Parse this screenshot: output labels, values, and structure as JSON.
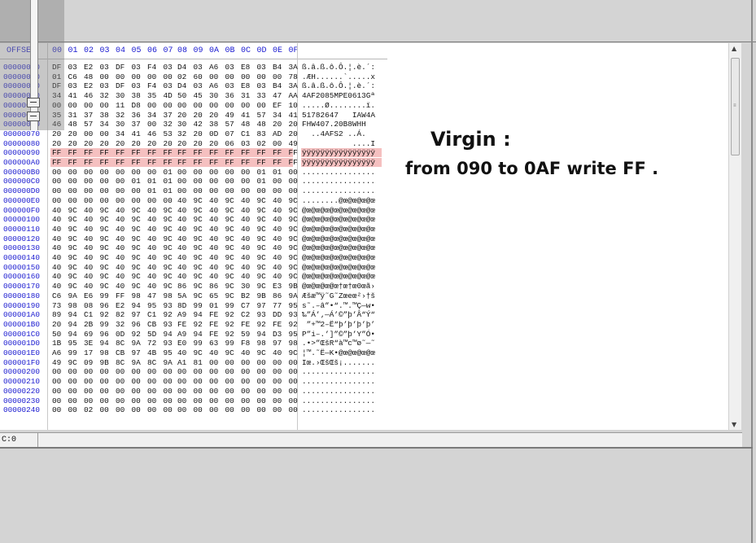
{
  "header": {
    "offset_label": "OFFSET",
    "columns": [
      "00",
      "01",
      "02",
      "03",
      "04",
      "05",
      "06",
      "07",
      "08",
      "09",
      "0A",
      "0B",
      "0C",
      "0D",
      "0E",
      "0F"
    ]
  },
  "rows": [
    {
      "offset": "00000000",
      "bytes": [
        "DF",
        "03",
        "E2",
        "03",
        "DF",
        "03",
        "F4",
        "03",
        "D4",
        "03",
        "A6",
        "03",
        "E8",
        "03",
        "B4",
        "3A"
      ],
      "ascii": "ß.â.ß.ô.Ô.¦.è.´:"
    },
    {
      "offset": "00000010",
      "bytes": [
        "01",
        "C6",
        "48",
        "00",
        "00",
        "00",
        "00",
        "00",
        "02",
        "60",
        "00",
        "00",
        "00",
        "00",
        "00",
        "78"
      ],
      "ascii": ".ÆH......`.....x"
    },
    {
      "offset": "00000020",
      "bytes": [
        "DF",
        "03",
        "E2",
        "03",
        "DF",
        "03",
        "F4",
        "03",
        "D4",
        "03",
        "A6",
        "03",
        "E8",
        "03",
        "B4",
        "3A"
      ],
      "ascii": "ß.â.ß.ô.Ô.¦.è.´:"
    },
    {
      "offset": "00000030",
      "bytes": [
        "34",
        "41",
        "46",
        "32",
        "30",
        "38",
        "35",
        "4D",
        "50",
        "45",
        "30",
        "36",
        "31",
        "33",
        "47",
        "AA"
      ],
      "ascii": "4AF2085MPE0613Gª"
    },
    {
      "offset": "00000040",
      "bytes": [
        "00",
        "00",
        "00",
        "00",
        "11",
        "D8",
        "00",
        "00",
        "00",
        "00",
        "00",
        "00",
        "00",
        "00",
        "EF",
        "10"
      ],
      "ascii": ".....Ø........ï."
    },
    {
      "offset": "00000050",
      "bytes": [
        "35",
        "31",
        "37",
        "38",
        "32",
        "36",
        "34",
        "37",
        "20",
        "20",
        "20",
        "49",
        "41",
        "57",
        "34",
        "41"
      ],
      "ascii": "51782647   IAW4A"
    },
    {
      "offset": "00000060",
      "bytes": [
        "46",
        "48",
        "57",
        "34",
        "30",
        "37",
        "00",
        "32",
        "30",
        "42",
        "38",
        "57",
        "48",
        "48",
        "20",
        "20"
      ],
      "ascii": "FHW407.20B8WHH  "
    },
    {
      "offset": "00000070",
      "bytes": [
        "20",
        "20",
        "00",
        "00",
        "34",
        "41",
        "46",
        "53",
        "32",
        "20",
        "0D",
        "07",
        "C1",
        "83",
        "AD",
        "20"
      ],
      "ascii": "  ..4AFS2 ..Á.­ "
    },
    {
      "offset": "00000080",
      "bytes": [
        "20",
        "20",
        "20",
        "20",
        "20",
        "20",
        "20",
        "20",
        "20",
        "20",
        "20",
        "06",
        "03",
        "02",
        "00",
        "49"
      ],
      "ascii": "           ....I"
    },
    {
      "offset": "00000090",
      "bytes": [
        "FF",
        "FF",
        "FF",
        "FF",
        "FF",
        "FF",
        "FF",
        "FF",
        "FF",
        "FF",
        "FF",
        "FF",
        "FF",
        "FF",
        "FF",
        "FF"
      ],
      "ascii": "ÿÿÿÿÿÿÿÿÿÿÿÿÿÿÿÿ",
      "highlight": true
    },
    {
      "offset": "000000A0",
      "bytes": [
        "FF",
        "FF",
        "FF",
        "FF",
        "FF",
        "FF",
        "FF",
        "FF",
        "FF",
        "FF",
        "FF",
        "FF",
        "FF",
        "FF",
        "FF",
        "FF"
      ],
      "ascii": "ÿÿÿÿÿÿÿÿÿÿÿÿÿÿÿÿ",
      "highlight": true
    },
    {
      "offset": "000000B0",
      "bytes": [
        "00",
        "00",
        "00",
        "00",
        "00",
        "00",
        "00",
        "01",
        "00",
        "00",
        "00",
        "00",
        "00",
        "01",
        "01",
        "00"
      ],
      "ascii": "................"
    },
    {
      "offset": "000000C0",
      "bytes": [
        "00",
        "00",
        "00",
        "00",
        "00",
        "01",
        "01",
        "01",
        "00",
        "00",
        "00",
        "00",
        "00",
        "01",
        "00",
        "00"
      ],
      "ascii": "................"
    },
    {
      "offset": "000000D0",
      "bytes": [
        "00",
        "00",
        "00",
        "00",
        "00",
        "00",
        "01",
        "01",
        "00",
        "00",
        "00",
        "00",
        "00",
        "00",
        "00",
        "00"
      ],
      "ascii": "................"
    },
    {
      "offset": "000000E0",
      "bytes": [
        "00",
        "00",
        "00",
        "00",
        "00",
        "00",
        "00",
        "00",
        "40",
        "9C",
        "40",
        "9C",
        "40",
        "9C",
        "40",
        "9C"
      ],
      "ascii": "........@œ@œ@œ@œ"
    },
    {
      "offset": "000000F0",
      "bytes": [
        "40",
        "9C",
        "40",
        "9C",
        "40",
        "9C",
        "40",
        "9C",
        "40",
        "9C",
        "40",
        "9C",
        "40",
        "9C",
        "40",
        "9C"
      ],
      "ascii": "@œ@œ@œ@œ@œ@œ@œ@œ"
    },
    {
      "offset": "00000100",
      "bytes": [
        "40",
        "9C",
        "40",
        "9C",
        "40",
        "9C",
        "40",
        "9C",
        "40",
        "9C",
        "40",
        "9C",
        "40",
        "9C",
        "40",
        "9C"
      ],
      "ascii": "@œ@œ@œ@œ@œ@œ@œ@œ"
    },
    {
      "offset": "00000110",
      "bytes": [
        "40",
        "9C",
        "40",
        "9C",
        "40",
        "9C",
        "40",
        "9C",
        "40",
        "9C",
        "40",
        "9C",
        "40",
        "9C",
        "40",
        "9C"
      ],
      "ascii": "@œ@œ@œ@œ@œ@œ@œ@œ"
    },
    {
      "offset": "00000120",
      "bytes": [
        "40",
        "9C",
        "40",
        "9C",
        "40",
        "9C",
        "40",
        "9C",
        "40",
        "9C",
        "40",
        "9C",
        "40",
        "9C",
        "40",
        "9C"
      ],
      "ascii": "@œ@œ@œ@œ@œ@œ@œ@œ"
    },
    {
      "offset": "00000130",
      "bytes": [
        "40",
        "9C",
        "40",
        "9C",
        "40",
        "9C",
        "40",
        "9C",
        "40",
        "9C",
        "40",
        "9C",
        "40",
        "9C",
        "40",
        "9C"
      ],
      "ascii": "@œ@œ@œ@œ@œ@œ@œ@œ"
    },
    {
      "offset": "00000140",
      "bytes": [
        "40",
        "9C",
        "40",
        "9C",
        "40",
        "9C",
        "40",
        "9C",
        "40",
        "9C",
        "40",
        "9C",
        "40",
        "9C",
        "40",
        "9C"
      ],
      "ascii": "@œ@œ@œ@œ@œ@œ@œ@œ"
    },
    {
      "offset": "00000150",
      "bytes": [
        "40",
        "9C",
        "40",
        "9C",
        "40",
        "9C",
        "40",
        "9C",
        "40",
        "9C",
        "40",
        "9C",
        "40",
        "9C",
        "40",
        "9C"
      ],
      "ascii": "@œ@œ@œ@œ@œ@œ@œ@œ"
    },
    {
      "offset": "00000160",
      "bytes": [
        "40",
        "9C",
        "40",
        "9C",
        "40",
        "9C",
        "40",
        "9C",
        "40",
        "9C",
        "40",
        "9C",
        "40",
        "9C",
        "40",
        "9C"
      ],
      "ascii": "@œ@œ@œ@œ@œ@œ@œ@œ"
    },
    {
      "offset": "00000170",
      "bytes": [
        "40",
        "9C",
        "40",
        "9C",
        "40",
        "9C",
        "40",
        "9C",
        "86",
        "9C",
        "86",
        "9C",
        "30",
        "9C",
        "E3",
        "9B"
      ],
      "ascii": "@œ@œ@œ@œ†œ†œ0œã›"
    },
    {
      "offset": "00000180",
      "bytes": [
        "C6",
        "9A",
        "E6",
        "99",
        "FF",
        "98",
        "47",
        "98",
        "5A",
        "9C",
        "65",
        "9C",
        "B2",
        "9B",
        "86",
        "9A"
      ],
      "ascii": "Æšæ™ÿ˜G˜Zœeœ²›†š"
    },
    {
      "offset": "00000190",
      "bytes": [
        "73",
        "98",
        "08",
        "96",
        "E2",
        "94",
        "95",
        "93",
        "8D",
        "99",
        "01",
        "99",
        "C7",
        "97",
        "77",
        "95"
      ],
      "ascii": "s˜.–â”•“.™.™Ç—w•"
    },
    {
      "offset": "000001A0",
      "bytes": [
        "89",
        "94",
        "C1",
        "92",
        "82",
        "97",
        "C1",
        "92",
        "A9",
        "94",
        "FE",
        "92",
        "C2",
        "93",
        "DD",
        "93"
      ],
      "ascii": "‰”Á’‚—Á’©”þ’Â“Ý“"
    },
    {
      "offset": "000001B0",
      "bytes": [
        "20",
        "94",
        "2B",
        "99",
        "32",
        "96",
        "CB",
        "93",
        "FE",
        "92",
        "FE",
        "92",
        "FE",
        "92",
        "FE",
        "92"
      ],
      "ascii": " ”+™2–Ë“þ’þ’þ’þ’"
    },
    {
      "offset": "000001C0",
      "bytes": [
        "50",
        "94",
        "69",
        "96",
        "0D",
        "92",
        "5D",
        "94",
        "A9",
        "94",
        "FE",
        "92",
        "59",
        "94",
        "D3",
        "95"
      ],
      "ascii": "P”i–.’]”©”þ’Y”Ó•"
    },
    {
      "offset": "000001D0",
      "bytes": [
        "1B",
        "95",
        "3E",
        "94",
        "8C",
        "9A",
        "72",
        "93",
        "E0",
        "99",
        "63",
        "99",
        "F8",
        "98",
        "97",
        "98"
      ],
      "ascii": ".•>”ŒšR“à™c™ø˜—˜"
    },
    {
      "offset": "000001E0",
      "bytes": [
        "A6",
        "99",
        "17",
        "98",
        "CB",
        "97",
        "4B",
        "95",
        "40",
        "9C",
        "40",
        "9C",
        "40",
        "9C",
        "40",
        "9C"
      ],
      "ascii": "¦™.˜Ë—K•@œ@œ@œ@œ"
    },
    {
      "offset": "000001F0",
      "bytes": [
        "49",
        "9C",
        "09",
        "9B",
        "8C",
        "9A",
        "8C",
        "9A",
        "A1",
        "81",
        "00",
        "00",
        "00",
        "00",
        "00",
        "00"
      ],
      "ascii": "Iœ.›ŒšŒš¡......."
    },
    {
      "offset": "00000200",
      "bytes": [
        "00",
        "00",
        "00",
        "00",
        "00",
        "00",
        "00",
        "00",
        "00",
        "00",
        "00",
        "00",
        "00",
        "00",
        "00",
        "00"
      ],
      "ascii": "................"
    },
    {
      "offset": "00000210",
      "bytes": [
        "00",
        "00",
        "00",
        "00",
        "00",
        "00",
        "00",
        "00",
        "00",
        "00",
        "00",
        "00",
        "00",
        "00",
        "00",
        "00"
      ],
      "ascii": "................"
    },
    {
      "offset": "00000220",
      "bytes": [
        "00",
        "00",
        "00",
        "00",
        "00",
        "00",
        "00",
        "00",
        "00",
        "00",
        "00",
        "00",
        "00",
        "00",
        "00",
        "00"
      ],
      "ascii": "................"
    },
    {
      "offset": "00000230",
      "bytes": [
        "00",
        "00",
        "00",
        "00",
        "00",
        "00",
        "00",
        "00",
        "00",
        "00",
        "00",
        "00",
        "00",
        "00",
        "00",
        "00"
      ],
      "ascii": "................"
    },
    {
      "offset": "00000240",
      "bytes": [
        "00",
        "00",
        "02",
        "00",
        "00",
        "00",
        "00",
        "00",
        "00",
        "00",
        "00",
        "00",
        "00",
        "00",
        "00",
        "00"
      ],
      "ascii": "................"
    }
  ],
  "note": {
    "line1": "Virgin :",
    "line2": "from 090 to 0AF write FF ."
  },
  "status": {
    "cursor": "C:0"
  },
  "colors": {
    "offset_text": "#1a1ad0",
    "highlight": "#f5c0c0",
    "chrome": "#d4d4d4"
  }
}
